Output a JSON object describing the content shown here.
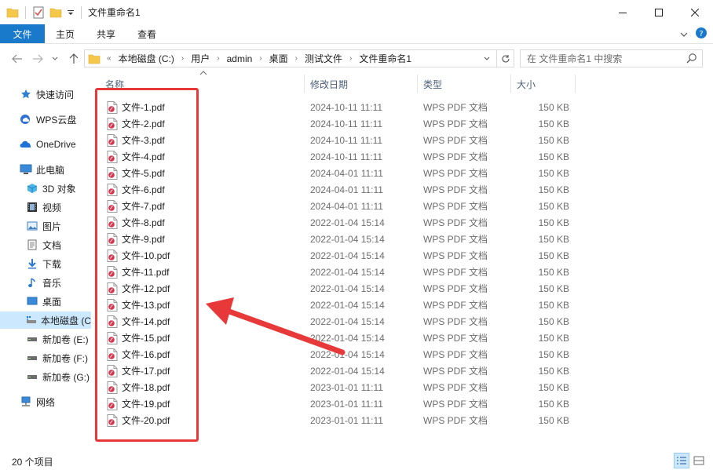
{
  "window": {
    "title": "文件重命名1"
  },
  "ribbon": {
    "tabs": [
      "文件",
      "主页",
      "共享",
      "查看"
    ]
  },
  "address": {
    "crumbs": [
      "本地磁盘 (C:)",
      "用户",
      "admin",
      "桌面",
      "测试文件",
      "文件重命名1"
    ],
    "overflow": "«"
  },
  "search": {
    "placeholder": "在 文件重命名1 中搜索"
  },
  "nav": {
    "items": [
      {
        "label": "快速访问",
        "icon": "star-icon"
      },
      {
        "label": "WPS云盘",
        "icon": "cloud-icon"
      },
      {
        "label": "OneDrive",
        "icon": "onedrive-icon"
      },
      {
        "label": "此电脑",
        "icon": "computer-icon"
      },
      {
        "label": "3D 对象",
        "icon": "cube-icon"
      },
      {
        "label": "视频",
        "icon": "video-icon"
      },
      {
        "label": "图片",
        "icon": "picture-icon"
      },
      {
        "label": "文档",
        "icon": "document-icon"
      },
      {
        "label": "下载",
        "icon": "download-icon"
      },
      {
        "label": "音乐",
        "icon": "music-icon"
      },
      {
        "label": "桌面",
        "icon": "desktop-icon"
      },
      {
        "label": "本地磁盘 (C",
        "icon": "drive-icon"
      },
      {
        "label": "新加卷 (E:)",
        "icon": "drive-icon"
      },
      {
        "label": "新加卷 (F:)",
        "icon": "drive-icon"
      },
      {
        "label": "新加卷 (G:)",
        "icon": "drive-icon"
      },
      {
        "label": "网络",
        "icon": "network-icon"
      }
    ]
  },
  "columns": {
    "name": "名称",
    "date": "修改日期",
    "type": "类型",
    "size": "大小"
  },
  "files": [
    {
      "name": "文件-1.pdf",
      "date": "2024-10-11 11:11",
      "type": "WPS PDF 文档",
      "size": "150 KB"
    },
    {
      "name": "文件-2.pdf",
      "date": "2024-10-11 11:11",
      "type": "WPS PDF 文档",
      "size": "150 KB"
    },
    {
      "name": "文件-3.pdf",
      "date": "2024-10-11 11:11",
      "type": "WPS PDF 文档",
      "size": "150 KB"
    },
    {
      "name": "文件-4.pdf",
      "date": "2024-10-11 11:11",
      "type": "WPS PDF 文档",
      "size": "150 KB"
    },
    {
      "name": "文件-5.pdf",
      "date": "2024-04-01 11:11",
      "type": "WPS PDF 文档",
      "size": "150 KB"
    },
    {
      "name": "文件-6.pdf",
      "date": "2024-04-01 11:11",
      "type": "WPS PDF 文档",
      "size": "150 KB"
    },
    {
      "name": "文件-7.pdf",
      "date": "2024-04-01 11:11",
      "type": "WPS PDF 文档",
      "size": "150 KB"
    },
    {
      "name": "文件-8.pdf",
      "date": "2022-01-04 15:14",
      "type": "WPS PDF 文档",
      "size": "150 KB"
    },
    {
      "name": "文件-9.pdf",
      "date": "2022-01-04 15:14",
      "type": "WPS PDF 文档",
      "size": "150 KB"
    },
    {
      "name": "文件-10.pdf",
      "date": "2022-01-04 15:14",
      "type": "WPS PDF 文档",
      "size": "150 KB"
    },
    {
      "name": "文件-11.pdf",
      "date": "2022-01-04 15:14",
      "type": "WPS PDF 文档",
      "size": "150 KB"
    },
    {
      "name": "文件-12.pdf",
      "date": "2022-01-04 15:14",
      "type": "WPS PDF 文档",
      "size": "150 KB"
    },
    {
      "name": "文件-13.pdf",
      "date": "2022-01-04 15:14",
      "type": "WPS PDF 文档",
      "size": "150 KB"
    },
    {
      "name": "文件-14.pdf",
      "date": "2022-01-04 15:14",
      "type": "WPS PDF 文档",
      "size": "150 KB"
    },
    {
      "name": "文件-15.pdf",
      "date": "2022-01-04 15:14",
      "type": "WPS PDF 文档",
      "size": "150 KB"
    },
    {
      "name": "文件-16.pdf",
      "date": "2022-01-04 15:14",
      "type": "WPS PDF 文档",
      "size": "150 KB"
    },
    {
      "name": "文件-17.pdf",
      "date": "2022-01-04 15:14",
      "type": "WPS PDF 文档",
      "size": "150 KB"
    },
    {
      "name": "文件-18.pdf",
      "date": "2023-01-01 11:11",
      "type": "WPS PDF 文档",
      "size": "150 KB"
    },
    {
      "name": "文件-19.pdf",
      "date": "2023-01-01 11:11",
      "type": "WPS PDF 文档",
      "size": "150 KB"
    },
    {
      "name": "文件-20.pdf",
      "date": "2023-01-01 11:11",
      "type": "WPS PDF 文档",
      "size": "150 KB"
    }
  ],
  "status": {
    "count": "20 个项目"
  },
  "colors": {
    "accent": "#1979ca",
    "selection": "#cce8ff",
    "annotation": "#e8393a",
    "pdf_icon": "#d9344d"
  }
}
